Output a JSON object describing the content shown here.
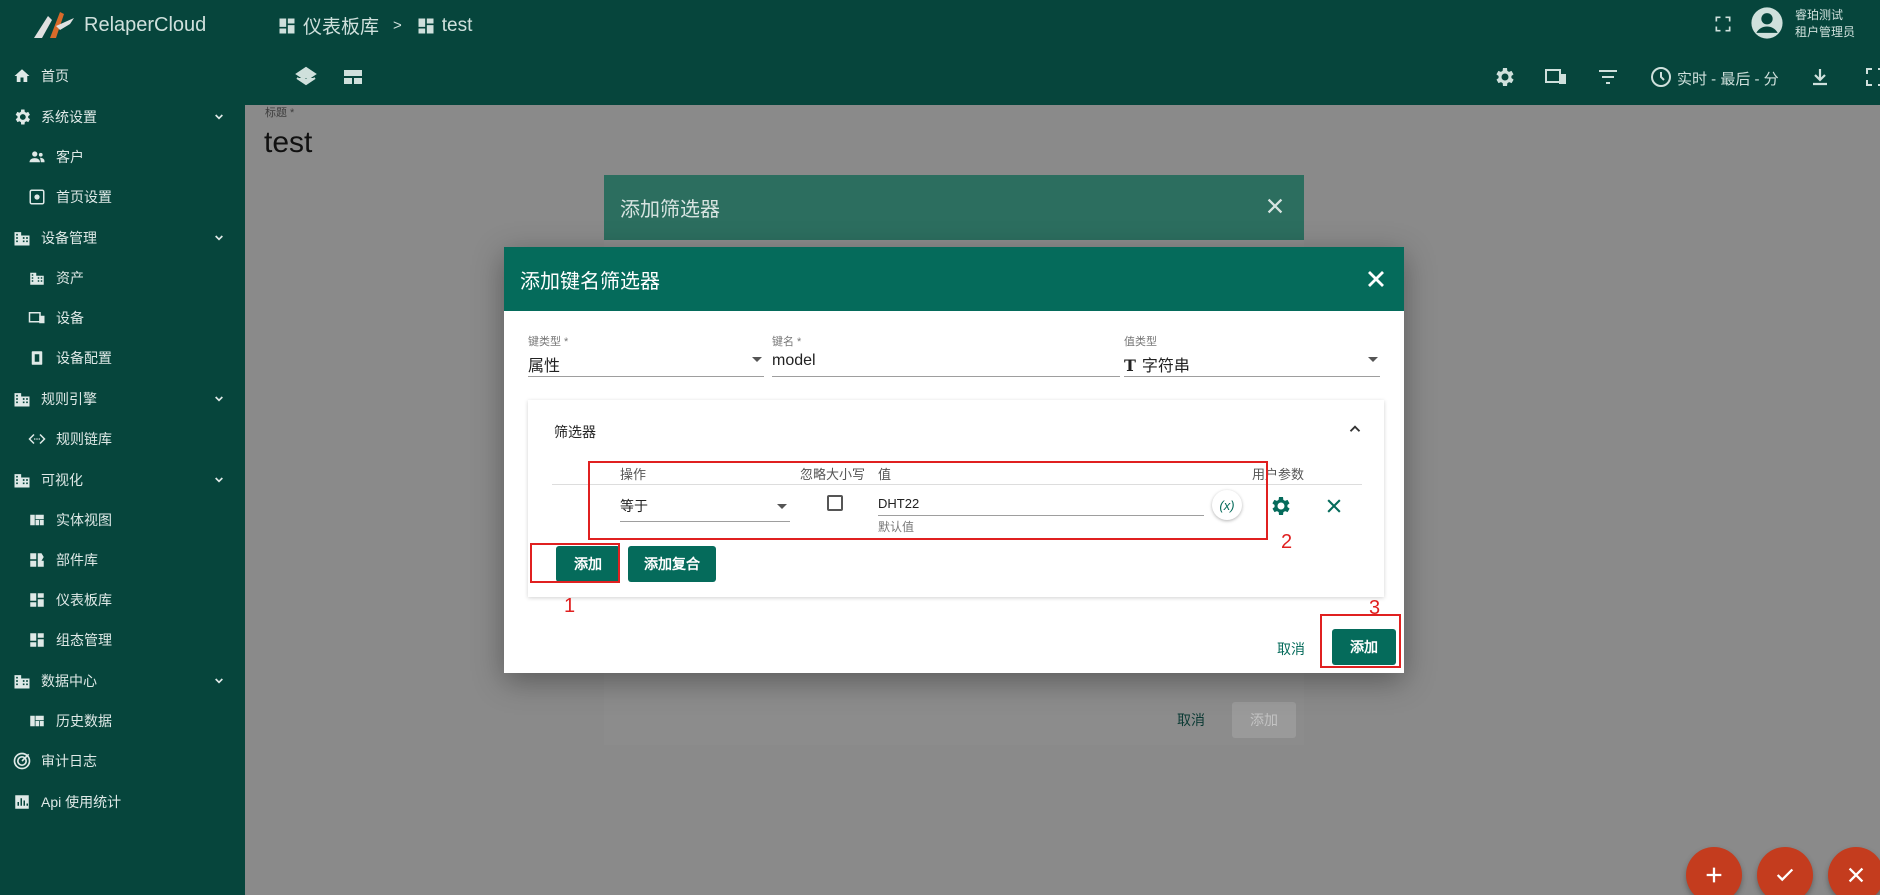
{
  "brand": {
    "name": "RelaperCloud"
  },
  "breadcrumb": {
    "parent": "仪表板库",
    "separator": ">",
    "current": "test"
  },
  "user": {
    "name": "睿珀测试",
    "role": "租户管理员"
  },
  "toolbar": {
    "timewindow": "实时 - 最后 - 分"
  },
  "sidebar": {
    "items": [
      {
        "label": "首页"
      },
      {
        "label": "系统设置"
      },
      {
        "label": "客户"
      },
      {
        "label": "首页设置"
      },
      {
        "label": "设备管理"
      },
      {
        "label": "资产"
      },
      {
        "label": "设备"
      },
      {
        "label": "设备配置"
      },
      {
        "label": "规则引擎"
      },
      {
        "label": "规则链库"
      },
      {
        "label": "可视化"
      },
      {
        "label": "实体视图"
      },
      {
        "label": "部件库"
      },
      {
        "label": "仪表板库"
      },
      {
        "label": "组态管理"
      },
      {
        "label": "数据中心"
      },
      {
        "label": "历史数据"
      },
      {
        "label": "审计日志"
      },
      {
        "label": "Api 使用统计"
      }
    ]
  },
  "page": {
    "title_label": "标题 *",
    "title": "test"
  },
  "back_dialog": {
    "title": "添加筛选器",
    "cancel": "取消",
    "add": "添加"
  },
  "dialog": {
    "title": "添加键名筛选器",
    "key_type": {
      "label": "键类型 *",
      "value": "属性"
    },
    "key_name": {
      "label": "键名 *",
      "value": "model"
    },
    "value_type": {
      "label": "值类型",
      "value": "字符串"
    },
    "filter_panel": {
      "title": "筛选器",
      "columns": {
        "operation": "操作",
        "ignore_case": "忽略大小写",
        "value": "值",
        "user_param": "用户参数"
      },
      "row": {
        "operation": "等于",
        "value": "DHT22",
        "default_value_hint": "默认值",
        "param_symbol": "(x)"
      },
      "add": "添加",
      "add_complex": "添加复合"
    },
    "cancel": "取消",
    "add": "添加"
  },
  "annotations": [
    "1",
    "2",
    "3"
  ],
  "colors": {
    "primary": "#056b5b",
    "sidebar": "#06453c",
    "annotation": "#e02020",
    "fab": "#c43c1e"
  }
}
